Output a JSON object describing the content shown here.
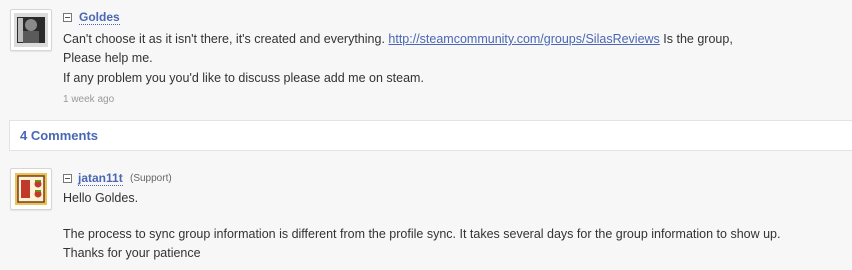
{
  "post": {
    "author": "Goldes",
    "line1_before_link": "Can't choose it as it isn't there, it's created and everything.",
    "link": "http://steamcommunity.com/groups/SilasReviews",
    "line1_after_link": "Is the group,",
    "line2": "Please help me.",
    "line3": "If any problem you you'd like to discuss please add me on steam.",
    "time": "1 week ago"
  },
  "comments_header": "4 Comments",
  "comment": {
    "author": "jatan11t",
    "role": "(Support)",
    "greeting": "Hello Goldes.",
    "line1": "The process to sync group information is different from the profile sync. It takes several days for the group information to show up.",
    "line2": "Thanks for your patience"
  },
  "colors": {
    "link": "#4a67b5",
    "avatar_red": "#c0392b",
    "avatar_green": "#6b8e23",
    "avatar_yellow": "#e8c35a"
  }
}
